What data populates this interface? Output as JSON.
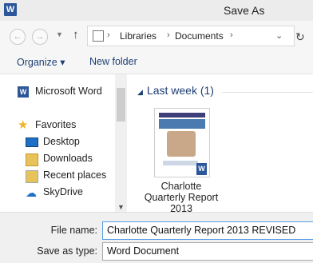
{
  "window": {
    "title": "Save As",
    "app_icon": "W"
  },
  "navigation": {
    "back_icon": "back-arrow-icon",
    "forward_icon": "forward-arrow-icon",
    "up_icon": "up-arrow-icon",
    "address": {
      "segments": [
        "Libraries",
        "Documents"
      ],
      "separator": "›"
    }
  },
  "toolbar": {
    "organize_label": "Organize ▾",
    "new_folder_label": "New folder"
  },
  "sidebar": {
    "items": [
      {
        "label": "Microsoft Word",
        "icon": "word-icon"
      },
      {
        "label": "Favorites",
        "icon": "star-icon"
      },
      {
        "label": "Desktop",
        "icon": "desktop-icon"
      },
      {
        "label": "Downloads",
        "icon": "downloads-icon"
      },
      {
        "label": "Recent places",
        "icon": "recent-places-icon"
      },
      {
        "label": "SkyDrive",
        "icon": "skydrive-icon"
      }
    ]
  },
  "content": {
    "group_header": "Last week (1)",
    "file": {
      "name_lines": [
        "Charlotte",
        "Quarterly Report",
        "2013"
      ]
    }
  },
  "form": {
    "file_name_label": "File name:",
    "file_name_value": "Charlotte Quarterly Report 2013 REVISED",
    "save_type_label": "Save as type:",
    "save_type_value": "Word Document"
  },
  "colors": {
    "accent": "#1e3f73",
    "word_blue": "#2b579a",
    "favorites_star": "#f0b429"
  }
}
